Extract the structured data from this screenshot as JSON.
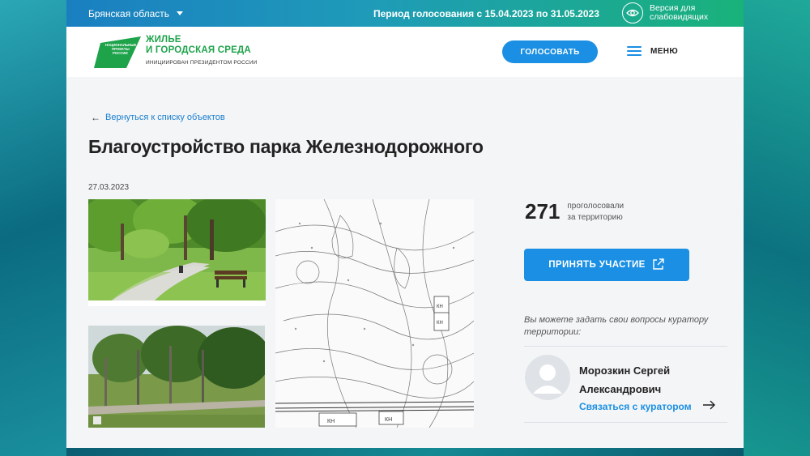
{
  "topbar": {
    "region": "Брянская область",
    "period": "Период голосования с 15.04.2023 по 31.05.2023",
    "visually_impaired_line1": "Версия для",
    "visually_impaired_line2": "слабовидящих"
  },
  "header": {
    "logo_badge_line1": "НАЦИОНАЛЬНЫЕ",
    "logo_badge_line2": "ПРОЕКТЫ",
    "logo_badge_line3": "РОССИИ",
    "logo_title_line1": "ЖИЛЬЕ",
    "logo_title_line2": "И ГОРОДСКАЯ СРЕДА",
    "logo_subtitle": "ИНИЦИИРОВАН ПРЕЗИДЕНТОМ РОССИИ",
    "vote_button": "ГОЛОСОВАТЬ",
    "menu_label": "МЕНЮ"
  },
  "content": {
    "back_link": "Вернуться к списку объектов",
    "title": "Благоустройство парка Железнодорожного",
    "date": "27.03.2023",
    "votes_count": "271",
    "votes_label_line1": "проголосовали",
    "votes_label_line2": "за территорию",
    "join_button": "ПРИНЯТЬ УЧАСТИЕ",
    "question_text": "Вы можете задать свои вопросы куратору территории:",
    "curator_name": "Морозкин Сергей Александрович",
    "contact_link": "Связаться с куратором"
  },
  "map_labels": [
    "КН",
    "КН",
    "КН",
    "КН"
  ],
  "colors": {
    "accent": "#1a8fe3",
    "brand_green": "#1ea34b",
    "page_bg": "#f4f5f7"
  }
}
